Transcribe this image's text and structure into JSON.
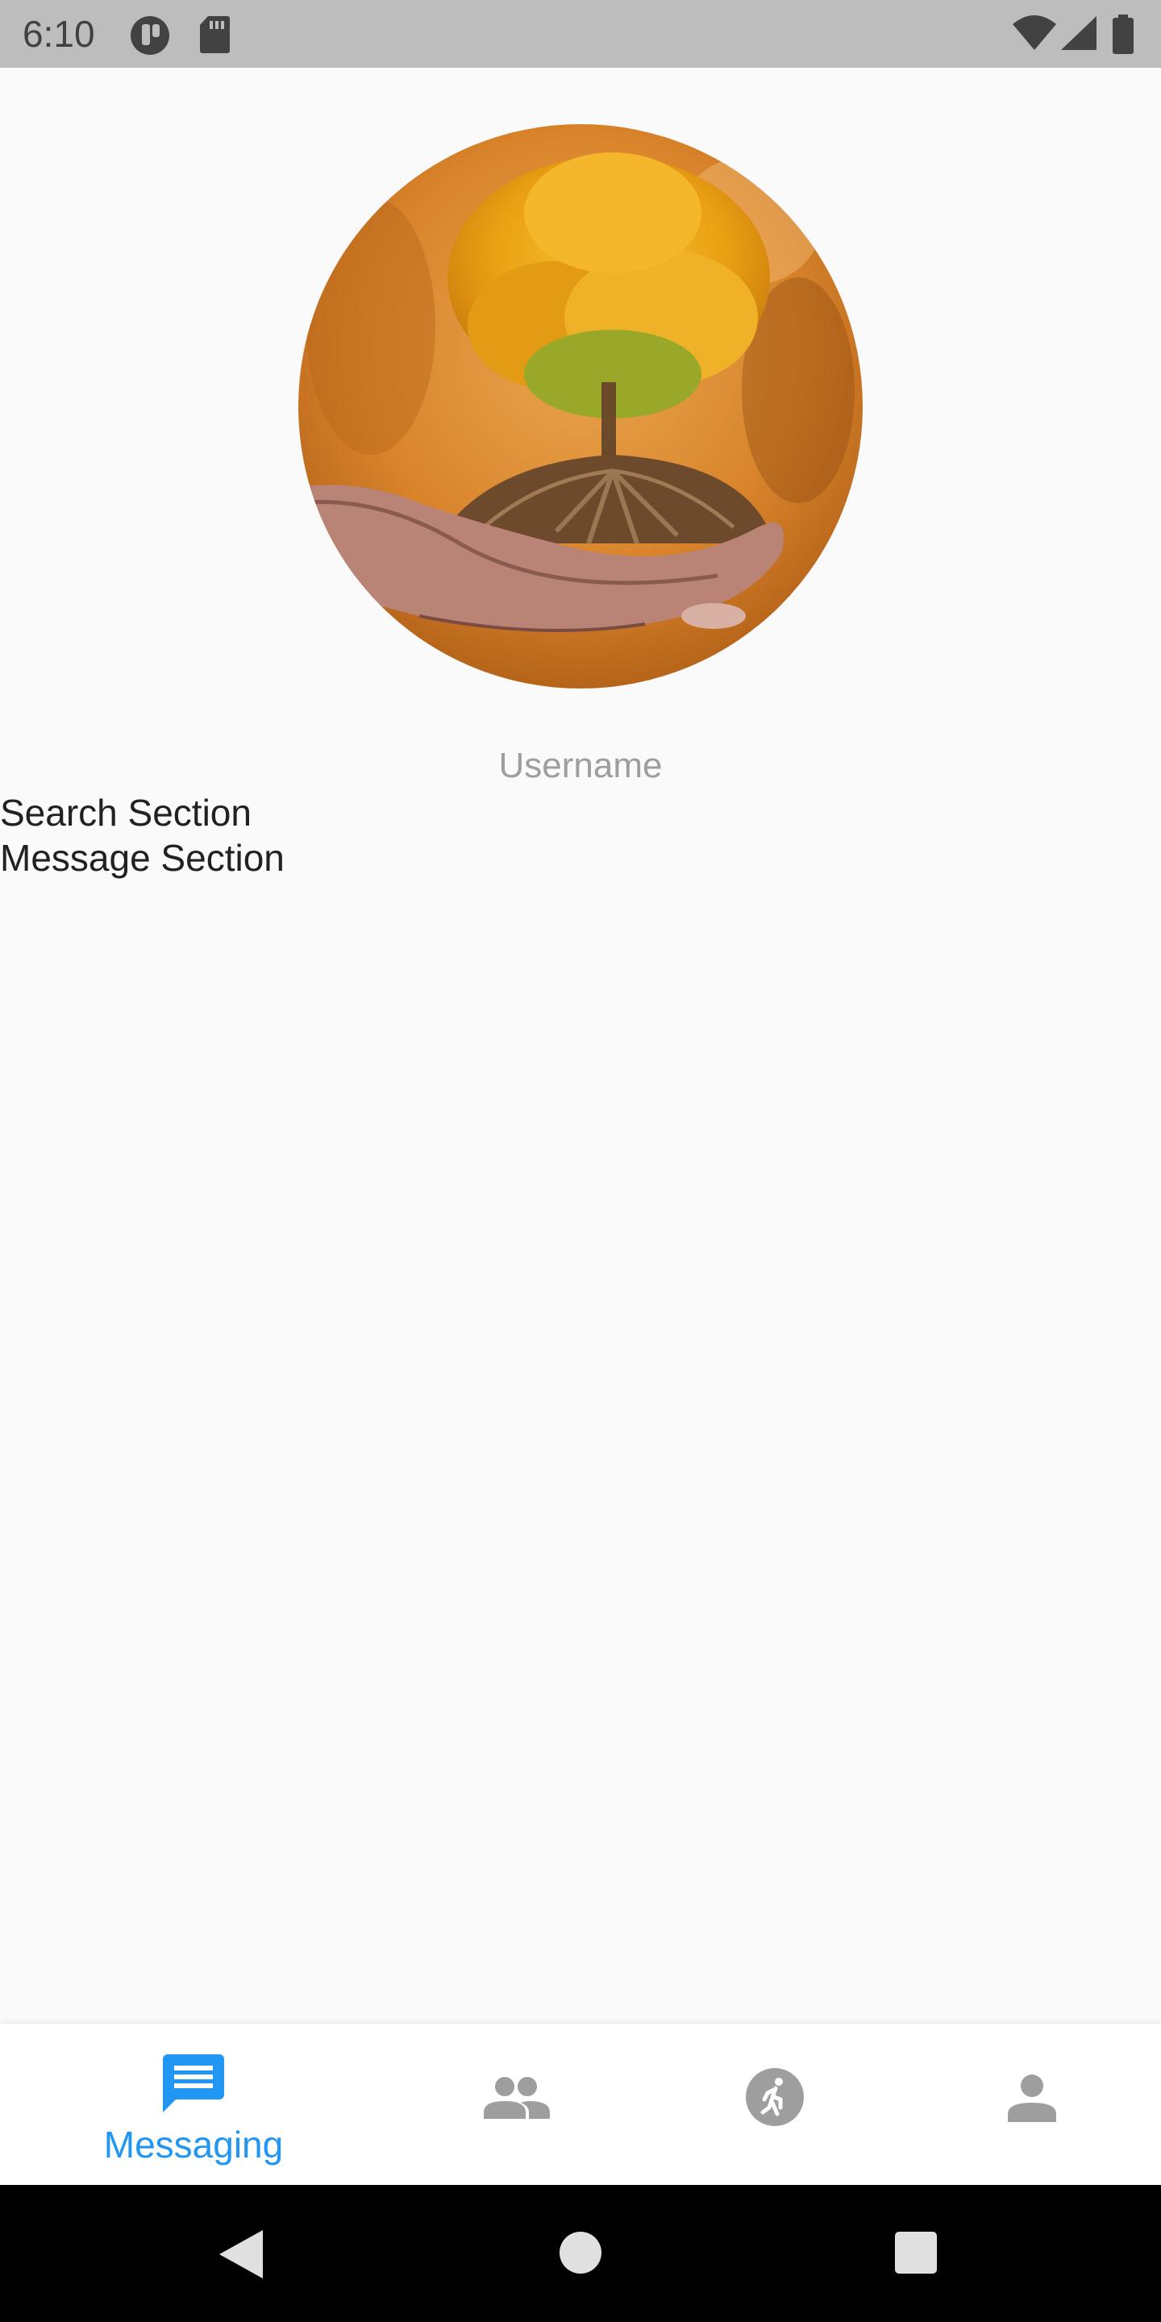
{
  "status_bar": {
    "time": "6:10",
    "icons": [
      "circle-app-icon",
      "sd-card-icon",
      "wifi-icon",
      "signal-icon",
      "battery-icon"
    ]
  },
  "profile": {
    "avatar_icon": "tree-in-hands-image",
    "username": "Username"
  },
  "sections": {
    "search": "Search Section",
    "message": "Message Section"
  },
  "bottom_nav": {
    "items": [
      {
        "icon": "message-icon",
        "label": "Messaging",
        "active": true
      },
      {
        "icon": "people-icon",
        "active": false
      },
      {
        "icon": "run-icon",
        "active": false
      },
      {
        "icon": "person-icon",
        "active": false
      }
    ],
    "active_color": "#2196f3",
    "inactive_color": "#9e9e9e"
  },
  "system_nav": {
    "buttons": [
      "back-icon",
      "home-icon",
      "recents-icon"
    ]
  }
}
